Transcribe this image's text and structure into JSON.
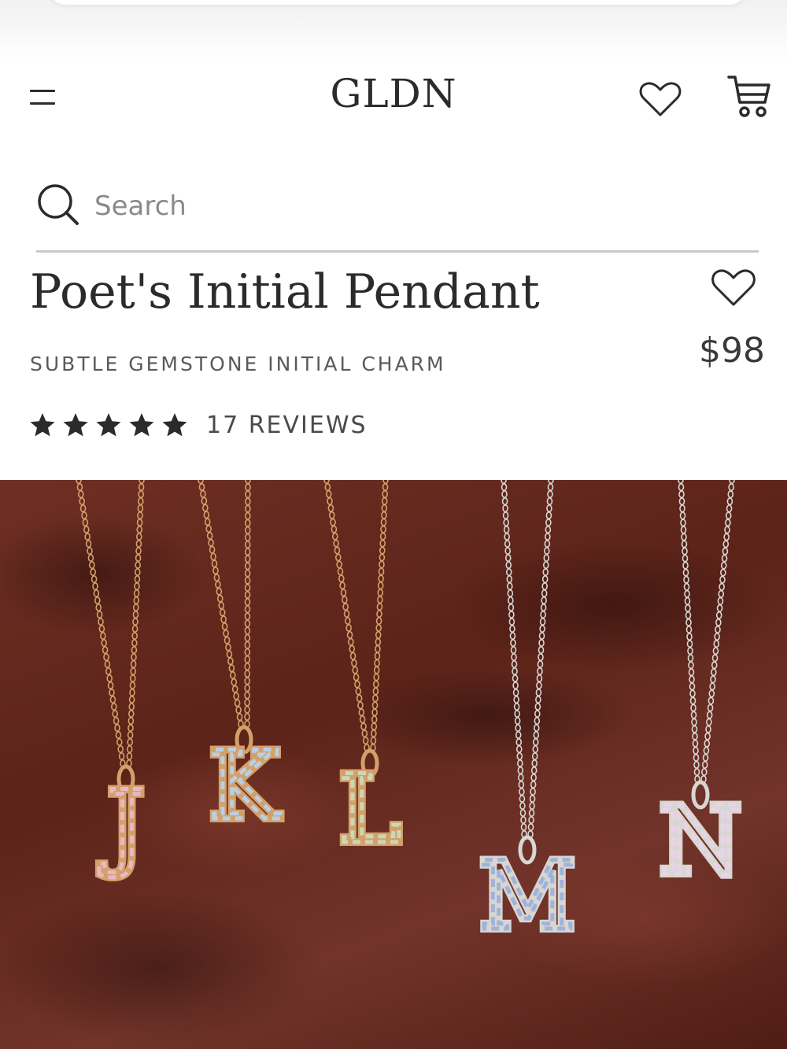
{
  "header": {
    "brand": "GLDN",
    "menu_icon": "hamburger-menu-icon",
    "wishlist_icon": "heart-outline-icon",
    "cart_icon": "shopping-cart-icon"
  },
  "search": {
    "placeholder": "Search",
    "value": "",
    "icon": "search-icon"
  },
  "product": {
    "title": "Poet's Initial Pendant",
    "subtitle": "SUBTLE GEMSTONE INITIAL CHARM",
    "price": "$98",
    "favorite_icon": "heart-outline-icon",
    "rating": {
      "stars": 5,
      "max_stars": 5,
      "reviews_label": "17 REVIEWS"
    }
  },
  "image": {
    "description_letters": [
      "J",
      "K",
      "L",
      "M",
      "N"
    ],
    "background_color": "#5c2319",
    "gold_chain_color": "#d4a06a",
    "silver_chain_color": "#d8d6d2"
  }
}
